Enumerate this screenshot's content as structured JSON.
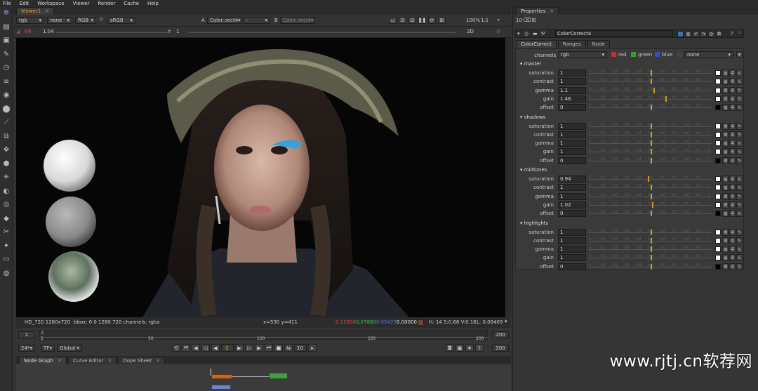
{
  "menubar": [
    "File",
    "Edit",
    "Workspace",
    "Viewer",
    "Render",
    "Cache",
    "Help"
  ],
  "viewer": {
    "tab_label": "Viewer1",
    "channels": "rgb",
    "alpha": "none",
    "colorspace": "RGB",
    "lut": "sRGB",
    "input_a": "Color..rect4",
    "input_a_label": "A",
    "input_b_sep": "-",
    "input_b_label": "B",
    "input_b": "Color..rect4",
    "zoom": "100%",
    "ratio": "1:1",
    "mode": "2D",
    "fstop": "f/8",
    "gain": "1.04",
    "y_label": "Y",
    "gamma": "1"
  },
  "infobar": {
    "format": "HD_720 1280x720",
    "bbox": "bbox: 0 0 1280 720 channels: rgba",
    "coords": "x=530 y=411",
    "r": "0.15906",
    "g": "0.07880",
    "b": "0.05429",
    "a": "0.00000",
    "hsv": "H: 14 S:0.66 V:0.16",
    "luma": "L: 0.09409",
    "swatch_color": "#6e4538"
  },
  "timeline": {
    "start": "1",
    "end": "200",
    "current": "2",
    "ticks": [
      "1",
      "50",
      "100",
      "150",
      "200"
    ],
    "fps": "24*",
    "tf": "TF",
    "global": "Global",
    "inc": "-2",
    "step": "10",
    "end_field": "200"
  },
  "bottom_tabs": [
    "Node Graph",
    "Curve Editor",
    "Dope Sheet"
  ],
  "properties": {
    "panel_title": "Properties",
    "count": "10",
    "node_name": "ColorCorrect4",
    "tabs": [
      "ColorCorrect",
      "Ranges",
      "Node"
    ],
    "channels_label": "channels",
    "channels_value": "rgb",
    "checks": [
      "red",
      "green",
      "blue"
    ],
    "mask_value": "none",
    "slider_ticks": [
      "0",
      "0.1",
      "0.2",
      "0.3",
      "0.4",
      "0.5",
      "0.6",
      "0.7",
      "0.8",
      "0.9",
      "1"
    ],
    "slider_color": "#c8a020",
    "sections": [
      {
        "name": "master",
        "rows": [
          {
            "label": "saturation",
            "value": "1",
            "fraction": 0.5
          },
          {
            "label": "contrast",
            "value": "1",
            "fraction": 0.5
          },
          {
            "label": "gamma",
            "value": "1.1",
            "fraction": 0.52
          },
          {
            "label": "gain",
            "value": "1.46",
            "fraction": 0.62
          },
          {
            "label": "offset",
            "value": "0",
            "fraction": 0.5
          }
        ]
      },
      {
        "name": "shadows",
        "rows": [
          {
            "label": "saturation",
            "value": "1",
            "fraction": 0.5
          },
          {
            "label": "contrast",
            "value": "1",
            "fraction": 0.5
          },
          {
            "label": "gamma",
            "value": "1",
            "fraction": 0.5
          },
          {
            "label": "gain",
            "value": "1",
            "fraction": 0.5
          },
          {
            "label": "offset",
            "value": "0",
            "fraction": 0.5
          }
        ]
      },
      {
        "name": "midtones",
        "rows": [
          {
            "label": "saturation",
            "value": "0.94",
            "fraction": 0.48
          },
          {
            "label": "contrast",
            "value": "1",
            "fraction": 0.5
          },
          {
            "label": "gamma",
            "value": "1",
            "fraction": 0.5
          },
          {
            "label": "gain",
            "value": "1.02",
            "fraction": 0.51
          },
          {
            "label": "offset",
            "value": "0",
            "fraction": 0.5
          }
        ]
      },
      {
        "name": "highlights",
        "rows": [
          {
            "label": "saturation",
            "value": "1",
            "fraction": 0.5
          },
          {
            "label": "contrast",
            "value": "1",
            "fraction": 0.5
          },
          {
            "label": "gamma",
            "value": "1",
            "fraction": 0.5
          },
          {
            "label": "gain",
            "value": "1",
            "fraction": 0.5
          },
          {
            "label": "offset",
            "value": "0",
            "fraction": 0.5
          }
        ]
      }
    ],
    "channel_count": "4"
  },
  "watermark": "www.rjtj.cn软荐网"
}
